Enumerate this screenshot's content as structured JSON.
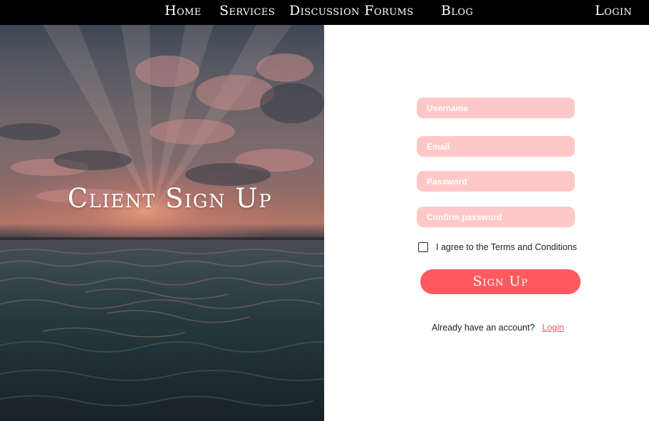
{
  "nav": {
    "items": [
      {
        "label": "Home"
      },
      {
        "label": "Services"
      },
      {
        "label": "Discussion Forums"
      },
      {
        "label": "Blog"
      }
    ],
    "login_label": "Login"
  },
  "hero": {
    "title": "Client Sign Up"
  },
  "form": {
    "username_placeholder": "Username",
    "email_placeholder": "Email",
    "password_placeholder": "Password",
    "confirm_placeholder": "Confirm password",
    "terms_label": "I agree to the Terms and Conditions",
    "terms_checked": false,
    "submit_label": "Sign Up",
    "have_account_text": "Already have an account?",
    "login_link_label": "Login"
  },
  "colors": {
    "nav_background": "#000000",
    "field_background": "#ffc8c8",
    "accent": "#ff5a5f"
  }
}
